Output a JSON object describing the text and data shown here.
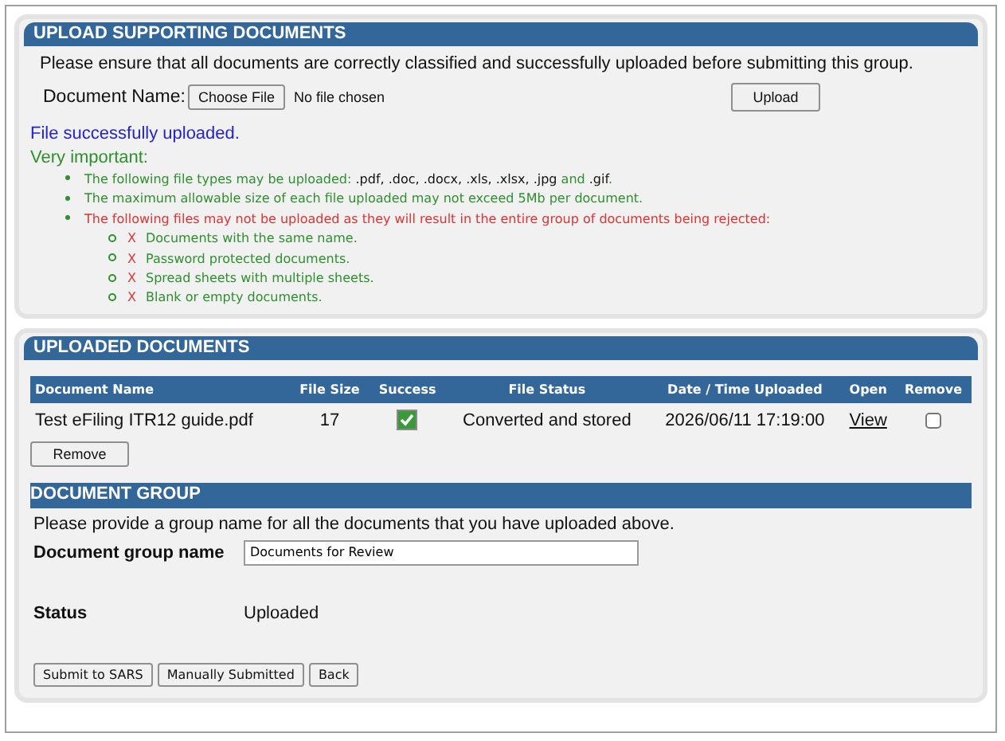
{
  "upload_panel": {
    "title": "UPLOAD SUPPORTING DOCUMENTS",
    "intro": "Please ensure that all documents are correctly classified and successfully uploaded before submitting this group.",
    "document_label": "Document Name:",
    "choose_button": "Choose File",
    "file_status": "No file chosen",
    "upload_button": "Upload",
    "message": "File successfully uploaded.",
    "important_heading": "Very important:",
    "notes": [
      {
        "kind": "info",
        "parts": [
          {
            "text": "The following file types may be uploaded: ",
            "kind": "plain"
          },
          {
            "text": ".pdf, .doc, .docx, .xls, .xlsx, .jpg",
            "kind": "code"
          },
          {
            "text": " and ",
            "kind": "plain"
          },
          {
            "text": ".gif",
            "kind": "code"
          },
          {
            "text": ".",
            "kind": "plain"
          }
        ]
      },
      {
        "kind": "info",
        "parts": [
          {
            "text": "The maximum allowable size of each file uploaded may not exceed 5Mb per document.",
            "kind": "plain"
          }
        ]
      },
      {
        "kind": "warning",
        "parts": [
          {
            "text": "The following files may not be uploaded as they will result in the entire group of documents being rejected:",
            "kind": "plain"
          }
        ],
        "children": [
          {
            "mark": "X",
            "text": "Documents with the same name."
          },
          {
            "mark": "X",
            "text": "Password protected documents."
          },
          {
            "mark": "X",
            "text": "Spread sheets with multiple sheets."
          },
          {
            "mark": "X",
            "text": "Blank or empty documents."
          }
        ]
      }
    ]
  },
  "uploaded_panel": {
    "title": "UPLOADED DOCUMENTS",
    "table": {
      "columns": [
        "Document Name",
        "File Size",
        "Success",
        "File Status",
        "Date / Time Uploaded",
        "Open",
        "Remove"
      ],
      "rows": [
        {
          "name": "Test eFiling ITR12 guide.pdf",
          "size": "17",
          "success": true,
          "status": "Converted and stored",
          "uploaded": "2026/06/11 17:19:00",
          "open_link": "View",
          "remove": false
        }
      ]
    },
    "remove_button": "Remove",
    "group": {
      "title": "DOCUMENT GROUP",
      "intro": "Please provide a group name for all the documents that you have uploaded above.",
      "name_label": "Document group name",
      "name_value": "Documents for Review",
      "status_label": "Status",
      "status_value": "Uploaded"
    },
    "buttons": [
      "Submit to SARS",
      "Manually Submitted",
      "Back"
    ]
  }
}
